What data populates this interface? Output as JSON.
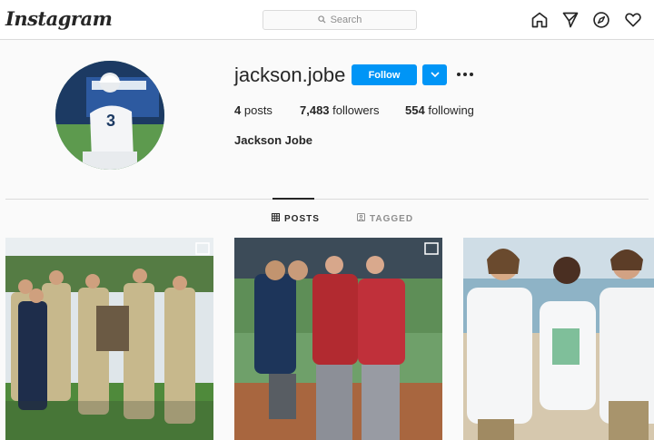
{
  "header": {
    "logo": "Instagram",
    "search_placeholder": "Search",
    "icons": [
      "home-icon",
      "direct-send-icon",
      "explore-compass-icon",
      "activity-heart-icon"
    ]
  },
  "profile": {
    "username": "jackson.jobe",
    "follow_label": "Follow",
    "posts_count": "4",
    "posts_label": "posts",
    "followers_count": "7,483",
    "followers_label": "followers",
    "following_count": "554",
    "following_label": "following",
    "full_name": "Jackson Jobe",
    "avatar_jersey_number": "3"
  },
  "tabs": [
    {
      "label": "POSTS",
      "active": true,
      "icon": "grid-icon"
    },
    {
      "label": "TAGGED",
      "active": false,
      "icon": "tagged-icon"
    }
  ],
  "colors": {
    "accent": "#0095f6",
    "border": "#dbdbdb",
    "background": "#fafafa"
  }
}
